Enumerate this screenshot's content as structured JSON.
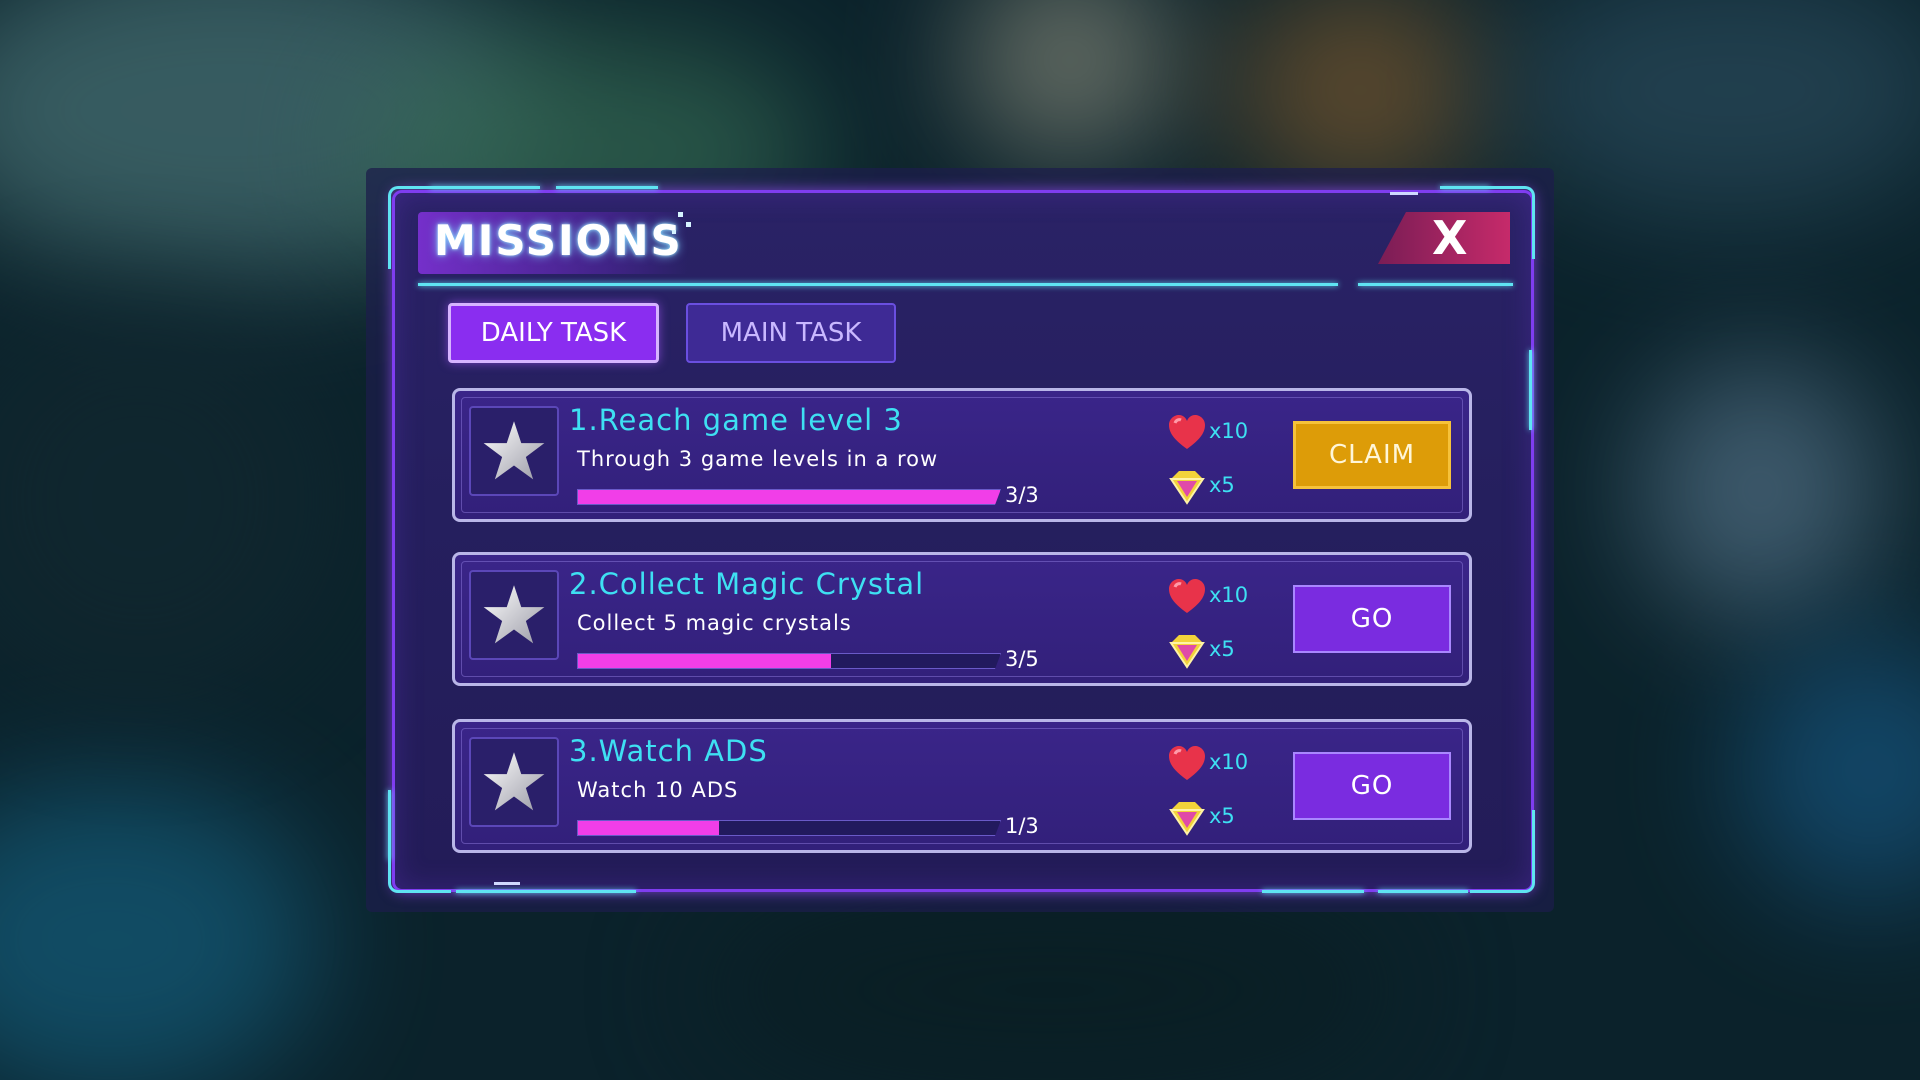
{
  "header": {
    "title": "MISSIONS",
    "close_label": "X"
  },
  "tabs": [
    {
      "label": "DAILY TASK",
      "active": true
    },
    {
      "label": "MAIN TASK",
      "active": false
    }
  ],
  "missions": [
    {
      "title": "1.Reach game level 3",
      "description": "Through 3 game levels in a row",
      "progress": "3/3",
      "progress_fraction": 1.0,
      "rewards": [
        {
          "icon": "heart-icon",
          "amount": "x10"
        },
        {
          "icon": "diamond-icon",
          "amount": "x5"
        }
      ],
      "action_label": "CLAIM",
      "action_type": "claim"
    },
    {
      "title": "2.Collect Magic Crystal",
      "description": "Collect 5 magic crystals",
      "progress": "3/5",
      "progress_fraction": 0.6,
      "rewards": [
        {
          "icon": "heart-icon",
          "amount": "x10"
        },
        {
          "icon": "diamond-icon",
          "amount": "x5"
        }
      ],
      "action_label": "GO",
      "action_type": "go"
    },
    {
      "title": "3.Watch ADS",
      "description": "Watch 10 ADS",
      "progress": "1/3",
      "progress_fraction": 0.333,
      "rewards": [
        {
          "icon": "heart-icon",
          "amount": "x10"
        },
        {
          "icon": "diamond-icon",
          "amount": "x5"
        }
      ],
      "action_label": "GO",
      "action_type": "go"
    }
  ],
  "colors": {
    "panel": "#251f5e",
    "frame": "#5fe4f2",
    "accent_purple": "#8a2df0",
    "title_cyan": "#3ee0f2",
    "progress_fill": "#f13ee8",
    "claim_button": "#dd9c08",
    "go_button": "#7a2ce0",
    "close_button": "#c62a6a"
  }
}
